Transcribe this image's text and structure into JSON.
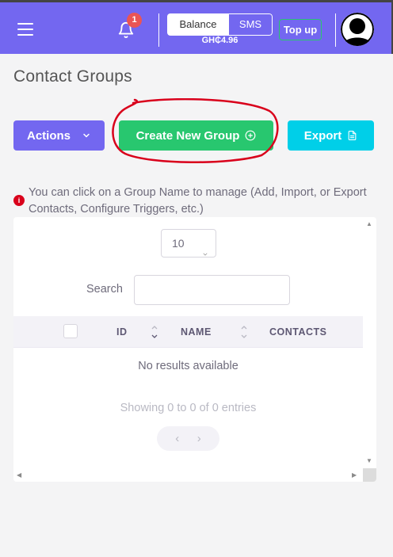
{
  "header": {
    "notification_count": "1",
    "balance_label": "Balance",
    "sms_label": "SMS",
    "balance_amount": "GH₵4.96",
    "topup_label": "Top up"
  },
  "page": {
    "title": "Contact Groups"
  },
  "toolbar": {
    "actions_label": "Actions",
    "create_label": "Create New Group",
    "export_label": "Export"
  },
  "info": {
    "icon_text": "i",
    "text": "You can click on a Group Name to manage (Add, Import, or Export Contacts, Configure Triggers, etc.)"
  },
  "table": {
    "page_length": "10",
    "search_label": "Search",
    "search_value": "",
    "columns": [
      "ID",
      "NAME",
      "CONTACTS"
    ],
    "empty_text": "No results available",
    "info_text": "Showing 0 to 0 of 0 entries",
    "prev_label": "‹",
    "next_label": "›"
  },
  "colors": {
    "primary": "#7367f0",
    "success": "#28c76f",
    "info": "#00cfe8",
    "danger": "#ea5455",
    "annotation": "#d9001b"
  }
}
